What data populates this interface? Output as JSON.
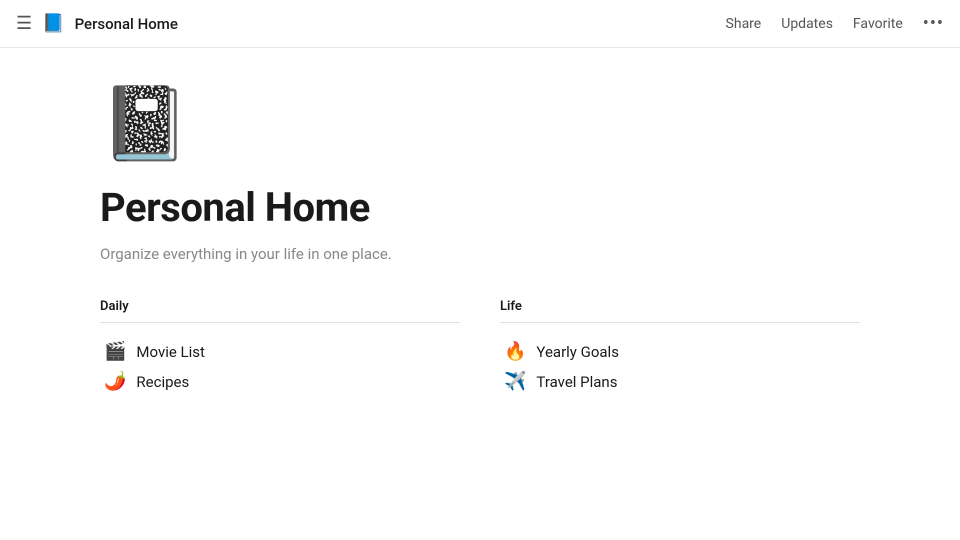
{
  "topbar": {
    "menu_label": "☰",
    "page_icon": "📘",
    "title": "Personal Home",
    "actions": {
      "share": "Share",
      "updates": "Updates",
      "favorite": "Favorite",
      "more": "•••"
    }
  },
  "page": {
    "cover_icon": "📓",
    "title": "Personal Home",
    "description": "Organize everything in your life in one place."
  },
  "columns": {
    "left": {
      "header": "Daily",
      "items": [
        {
          "emoji": "🎬",
          "label": "Movie List"
        },
        {
          "emoji": "🌶️",
          "label": "Recipes"
        }
      ]
    },
    "right": {
      "header": "Life",
      "items": [
        {
          "emoji": "🔥",
          "label": "Yearly Goals"
        },
        {
          "emoji": "✈️",
          "label": "Travel Plans"
        }
      ]
    }
  }
}
